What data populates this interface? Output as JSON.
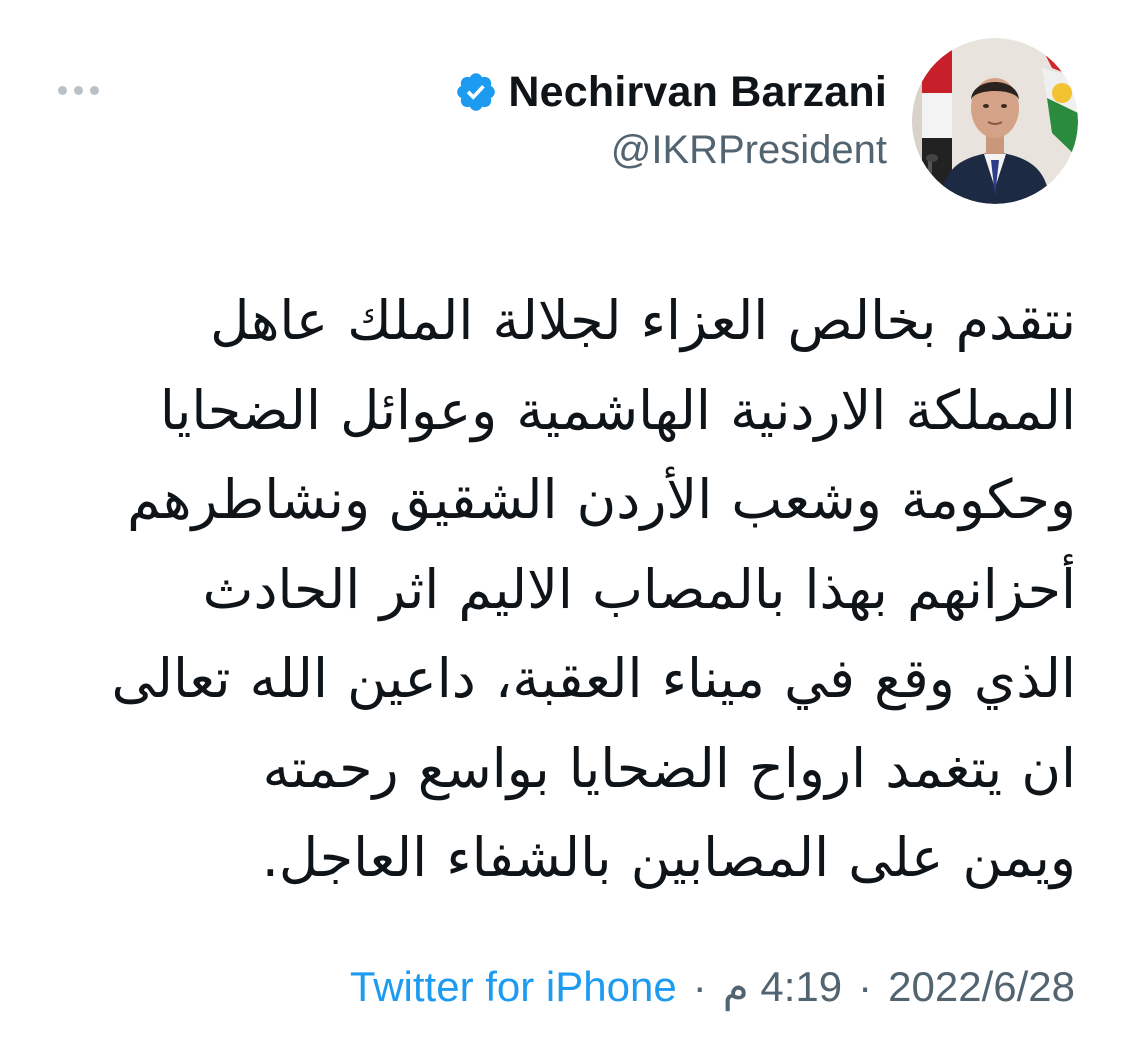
{
  "author": {
    "display_name": "Nechirvan Barzani",
    "handle": "@IKRPresident",
    "verified_icon": "verified-badge-icon"
  },
  "tweet": {
    "lines": [
      "نتقدم بخالص العزاء لجلالة الملك عاهل",
      "المملكة الاردنية الهاشمية وعوائل الضحايا",
      "وحكومة وشعب الأردن الشقيق ونشاطرهم",
      "أحزانهم بهذا بالمصاب الاليم اثر الحادث",
      "الذي وقع في ميناء العقبة، داعين الله تعالى",
      "ان يتغمد ارواح الضحايا بواسع رحمته",
      "ويمن على المصابين بالشفاء العاجل."
    ]
  },
  "meta": {
    "source": "Twitter for iPhone",
    "separator": "·",
    "time": "4:19 م",
    "date": "2022/6/28"
  },
  "colors": {
    "accent": "#1d9bf0",
    "secondary_text": "#536471",
    "primary_text": "#0f1419"
  }
}
